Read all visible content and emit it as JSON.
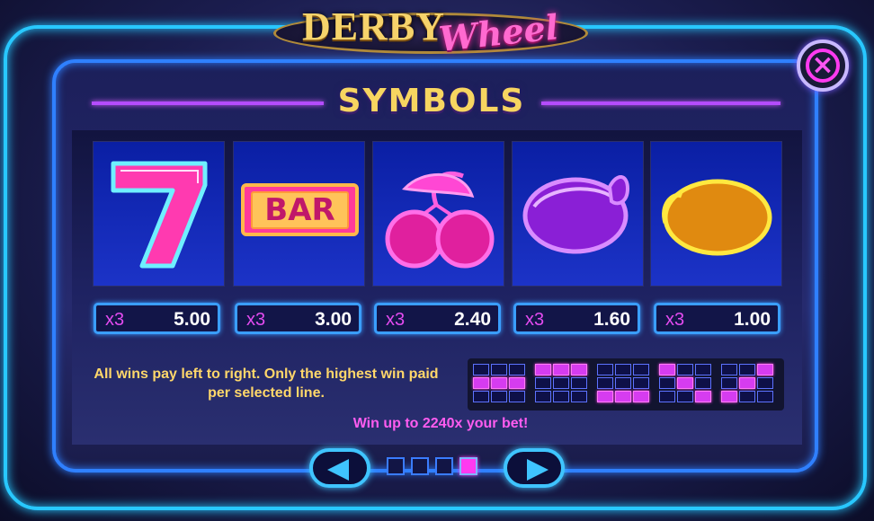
{
  "logo": {
    "word1": "DERBY",
    "word2": "Wheel"
  },
  "close_label": "×",
  "title": "SYMBOLS",
  "symbols": [
    {
      "icon": "seven-icon",
      "count": "x3",
      "value": "5.00"
    },
    {
      "icon": "bar-icon",
      "count": "x3",
      "value": "3.00",
      "icon_text": "BAR"
    },
    {
      "icon": "cherry-icon",
      "count": "x3",
      "value": "2.40"
    },
    {
      "icon": "plum-icon",
      "count": "x3",
      "value": "1.60"
    },
    {
      "icon": "lemon-icon",
      "count": "x3",
      "value": "1.00"
    }
  ],
  "rules_text": "All wins pay left to right. Only the highest win paid per selected line.",
  "win_text": "Win up to 2240x your bet!",
  "paylines": [
    [
      [
        0,
        0,
        0
      ],
      [
        1,
        1,
        1
      ],
      [
        0,
        0,
        0
      ]
    ],
    [
      [
        1,
        1,
        1
      ],
      [
        0,
        0,
        0
      ],
      [
        0,
        0,
        0
      ]
    ],
    [
      [
        0,
        0,
        0
      ],
      [
        0,
        0,
        0
      ],
      [
        1,
        1,
        1
      ]
    ],
    [
      [
        1,
        0,
        0
      ],
      [
        0,
        1,
        0
      ],
      [
        0,
        0,
        1
      ]
    ],
    [
      [
        0,
        0,
        1
      ],
      [
        0,
        1,
        0
      ],
      [
        1,
        0,
        0
      ]
    ]
  ],
  "pagination": {
    "total": 4,
    "current": 4
  },
  "colors": {
    "neon_blue": "#28c8ff",
    "neon_pink": "#ff3af0",
    "gold": "#f7d560",
    "tile_blue": "#1c33c7"
  }
}
